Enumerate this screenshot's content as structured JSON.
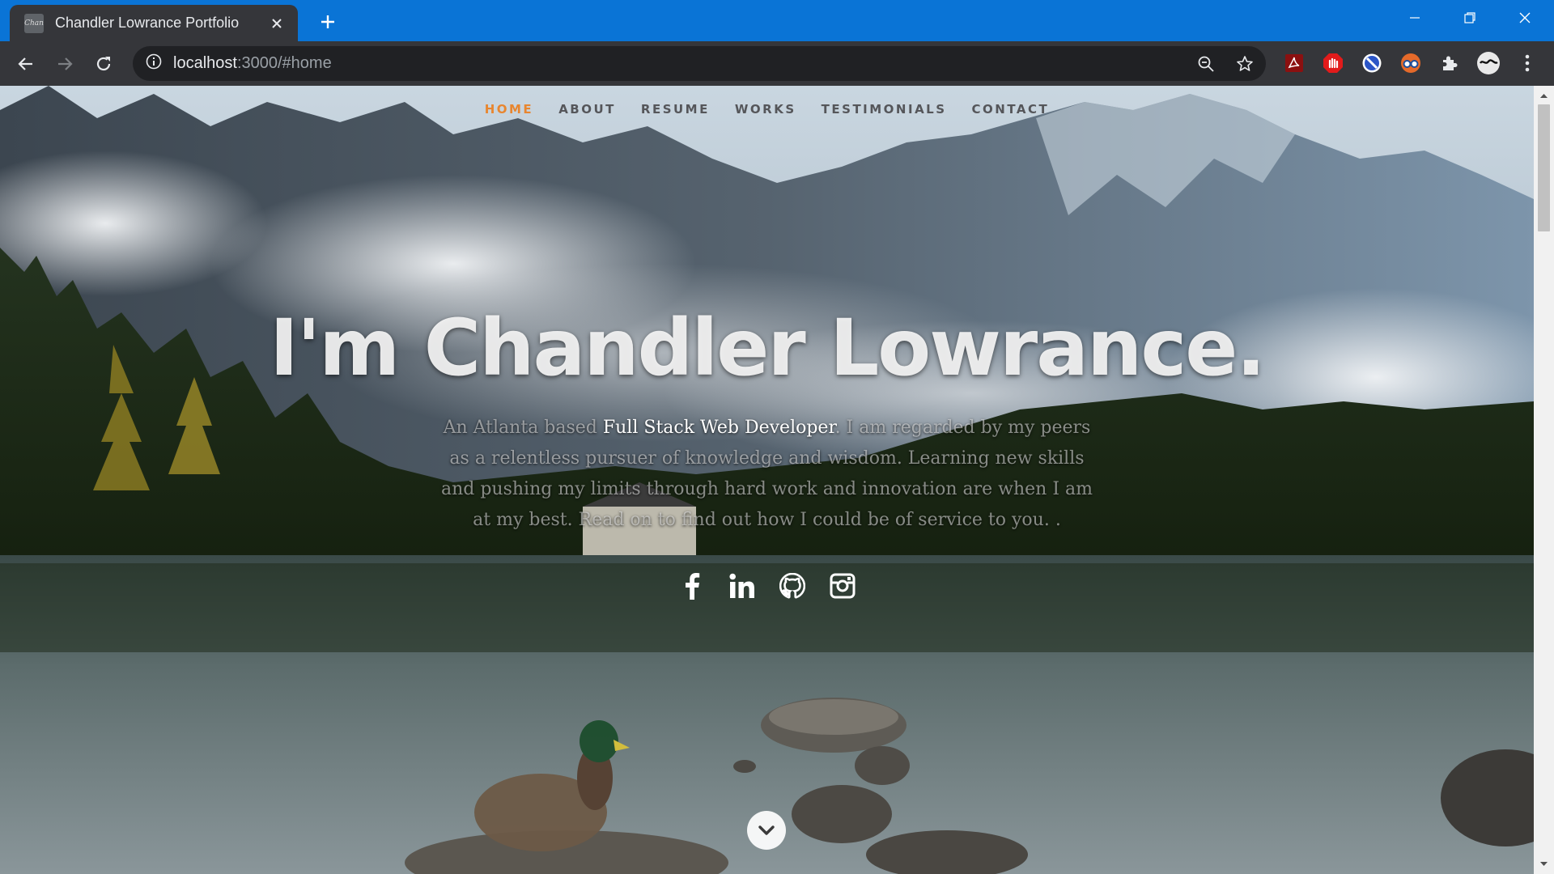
{
  "browser": {
    "tab": {
      "title": "Chandler Lowrance Portfolio",
      "favicon_text": "Chan"
    },
    "address_bar": {
      "url_host": "localhost",
      "url_rest": ":3000/#home"
    }
  },
  "page": {
    "nav": {
      "items": [
        {
          "label": "Home",
          "active": true
        },
        {
          "label": "About",
          "active": false
        },
        {
          "label": "Resume",
          "active": false
        },
        {
          "label": "Works",
          "active": false
        },
        {
          "label": "Testimonials",
          "active": false
        },
        {
          "label": "Contact",
          "active": false
        }
      ]
    },
    "hero": {
      "headline": "I'm Chandler Lowrance.",
      "intro_prefix": "An Atlanta based ",
      "intro_role": "Full Stack Web Developer",
      "intro_suffix": ". I am regarded by my peers as a relentless pursuer of knowledge and wisdom. Learning new skills and pushing my limits through hard work and innovation are when I am at my best. Read on to find out how I could be of service to you. ."
    },
    "social": [
      "facebook-icon",
      "linkedin-icon",
      "github-icon",
      "instagram-icon"
    ]
  },
  "colors": {
    "titlebar": "#0a74d6",
    "nav_active": "#e8862f",
    "nav_inactive": "#55565a"
  }
}
